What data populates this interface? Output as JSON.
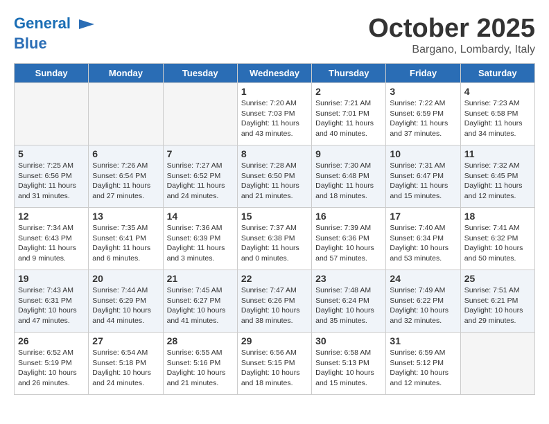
{
  "header": {
    "logo_line1": "General",
    "logo_line2": "Blue",
    "month": "October 2025",
    "location": "Bargano, Lombardy, Italy"
  },
  "days_of_week": [
    "Sunday",
    "Monday",
    "Tuesday",
    "Wednesday",
    "Thursday",
    "Friday",
    "Saturday"
  ],
  "weeks": [
    [
      {
        "day": "",
        "text": ""
      },
      {
        "day": "",
        "text": ""
      },
      {
        "day": "",
        "text": ""
      },
      {
        "day": "1",
        "text": "Sunrise: 7:20 AM\nSunset: 7:03 PM\nDaylight: 11 hours and 43 minutes."
      },
      {
        "day": "2",
        "text": "Sunrise: 7:21 AM\nSunset: 7:01 PM\nDaylight: 11 hours and 40 minutes."
      },
      {
        "day": "3",
        "text": "Sunrise: 7:22 AM\nSunset: 6:59 PM\nDaylight: 11 hours and 37 minutes."
      },
      {
        "day": "4",
        "text": "Sunrise: 7:23 AM\nSunset: 6:58 PM\nDaylight: 11 hours and 34 minutes."
      }
    ],
    [
      {
        "day": "5",
        "text": "Sunrise: 7:25 AM\nSunset: 6:56 PM\nDaylight: 11 hours and 31 minutes."
      },
      {
        "day": "6",
        "text": "Sunrise: 7:26 AM\nSunset: 6:54 PM\nDaylight: 11 hours and 27 minutes."
      },
      {
        "day": "7",
        "text": "Sunrise: 7:27 AM\nSunset: 6:52 PM\nDaylight: 11 hours and 24 minutes."
      },
      {
        "day": "8",
        "text": "Sunrise: 7:28 AM\nSunset: 6:50 PM\nDaylight: 11 hours and 21 minutes."
      },
      {
        "day": "9",
        "text": "Sunrise: 7:30 AM\nSunset: 6:48 PM\nDaylight: 11 hours and 18 minutes."
      },
      {
        "day": "10",
        "text": "Sunrise: 7:31 AM\nSunset: 6:47 PM\nDaylight: 11 hours and 15 minutes."
      },
      {
        "day": "11",
        "text": "Sunrise: 7:32 AM\nSunset: 6:45 PM\nDaylight: 11 hours and 12 minutes."
      }
    ],
    [
      {
        "day": "12",
        "text": "Sunrise: 7:34 AM\nSunset: 6:43 PM\nDaylight: 11 hours and 9 minutes."
      },
      {
        "day": "13",
        "text": "Sunrise: 7:35 AM\nSunset: 6:41 PM\nDaylight: 11 hours and 6 minutes."
      },
      {
        "day": "14",
        "text": "Sunrise: 7:36 AM\nSunset: 6:39 PM\nDaylight: 11 hours and 3 minutes."
      },
      {
        "day": "15",
        "text": "Sunrise: 7:37 AM\nSunset: 6:38 PM\nDaylight: 11 hours and 0 minutes."
      },
      {
        "day": "16",
        "text": "Sunrise: 7:39 AM\nSunset: 6:36 PM\nDaylight: 10 hours and 57 minutes."
      },
      {
        "day": "17",
        "text": "Sunrise: 7:40 AM\nSunset: 6:34 PM\nDaylight: 10 hours and 53 minutes."
      },
      {
        "day": "18",
        "text": "Sunrise: 7:41 AM\nSunset: 6:32 PM\nDaylight: 10 hours and 50 minutes."
      }
    ],
    [
      {
        "day": "19",
        "text": "Sunrise: 7:43 AM\nSunset: 6:31 PM\nDaylight: 10 hours and 47 minutes."
      },
      {
        "day": "20",
        "text": "Sunrise: 7:44 AM\nSunset: 6:29 PM\nDaylight: 10 hours and 44 minutes."
      },
      {
        "day": "21",
        "text": "Sunrise: 7:45 AM\nSunset: 6:27 PM\nDaylight: 10 hours and 41 minutes."
      },
      {
        "day": "22",
        "text": "Sunrise: 7:47 AM\nSunset: 6:26 PM\nDaylight: 10 hours and 38 minutes."
      },
      {
        "day": "23",
        "text": "Sunrise: 7:48 AM\nSunset: 6:24 PM\nDaylight: 10 hours and 35 minutes."
      },
      {
        "day": "24",
        "text": "Sunrise: 7:49 AM\nSunset: 6:22 PM\nDaylight: 10 hours and 32 minutes."
      },
      {
        "day": "25",
        "text": "Sunrise: 7:51 AM\nSunset: 6:21 PM\nDaylight: 10 hours and 29 minutes."
      }
    ],
    [
      {
        "day": "26",
        "text": "Sunrise: 6:52 AM\nSunset: 5:19 PM\nDaylight: 10 hours and 26 minutes."
      },
      {
        "day": "27",
        "text": "Sunrise: 6:54 AM\nSunset: 5:18 PM\nDaylight: 10 hours and 24 minutes."
      },
      {
        "day": "28",
        "text": "Sunrise: 6:55 AM\nSunset: 5:16 PM\nDaylight: 10 hours and 21 minutes."
      },
      {
        "day": "29",
        "text": "Sunrise: 6:56 AM\nSunset: 5:15 PM\nDaylight: 10 hours and 18 minutes."
      },
      {
        "day": "30",
        "text": "Sunrise: 6:58 AM\nSunset: 5:13 PM\nDaylight: 10 hours and 15 minutes."
      },
      {
        "day": "31",
        "text": "Sunrise: 6:59 AM\nSunset: 5:12 PM\nDaylight: 10 hours and 12 minutes."
      },
      {
        "day": "",
        "text": ""
      }
    ]
  ]
}
